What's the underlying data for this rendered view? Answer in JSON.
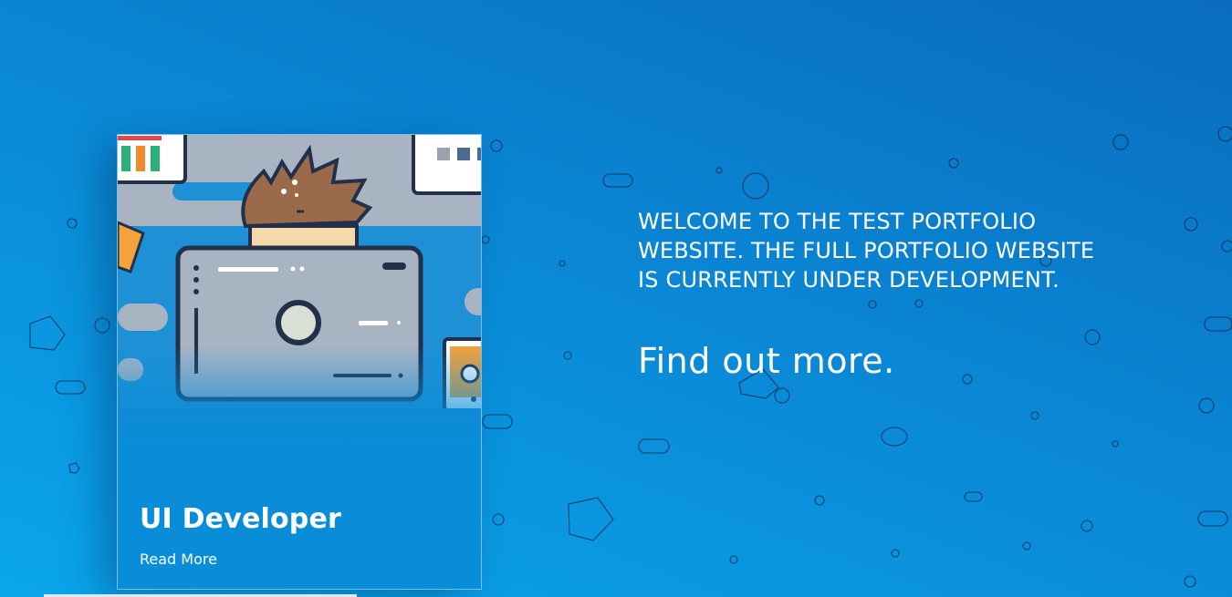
{
  "card": {
    "title": "UI Developer",
    "link_label": "Read More"
  },
  "intro": {
    "text": "Welcome to the test portfolio website. The full portfolio website is currently under development.",
    "cta_label": "Find out more."
  },
  "colors": {
    "background_top": "#0a6cbd",
    "background_bottom": "#0aa6ec",
    "text": "#ffffff"
  }
}
